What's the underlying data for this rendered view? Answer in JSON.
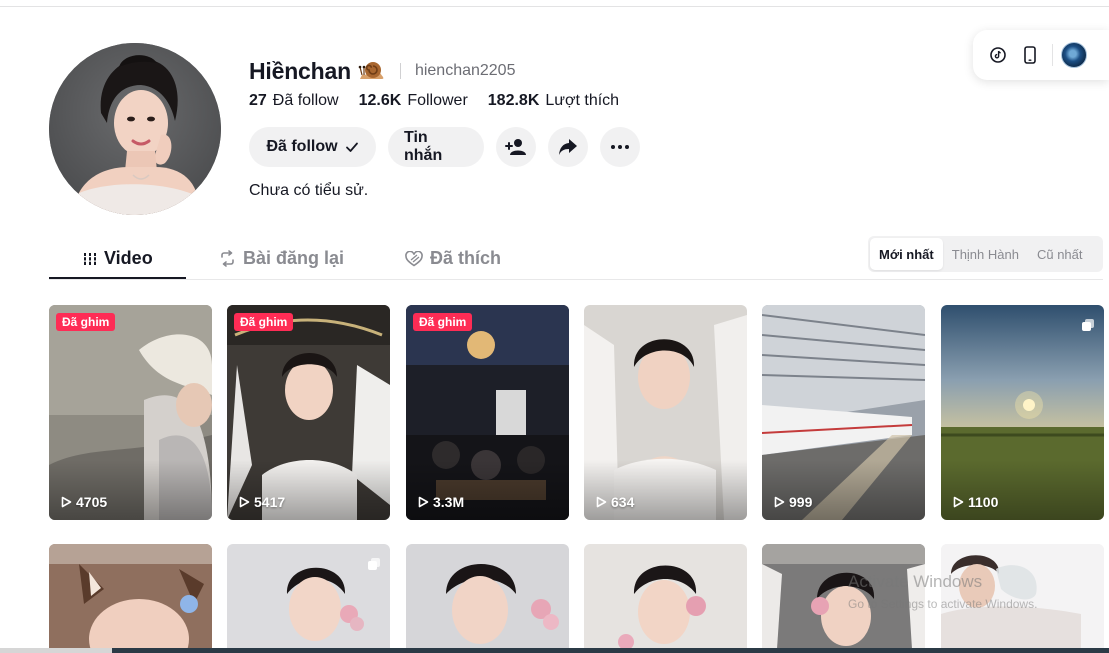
{
  "profile": {
    "display_name": "Hiềnchan",
    "username": "hienchan2205",
    "stats": [
      {
        "value": "27",
        "label": "Đã follow"
      },
      {
        "value": "12.6K",
        "label": "Follower"
      },
      {
        "value": "182.8K",
        "label": "Lượt thích"
      }
    ],
    "actions": {
      "follow_label": "Đã follow",
      "message_label": "Tin nhắn"
    },
    "bio": "Chưa có tiểu sử."
  },
  "tabs": [
    {
      "label": "Video",
      "icon": "grid-lines-icon",
      "active": true
    },
    {
      "label": "Bài đăng lại",
      "icon": "repost-icon",
      "active": false
    },
    {
      "label": "Đã thích",
      "icon": "heart-hidden-icon",
      "active": false
    }
  ],
  "sort": [
    {
      "label": "Mới nhất",
      "active": true
    },
    {
      "label": "Thịnh Hành",
      "active": false
    },
    {
      "label": "Cũ nhất",
      "active": false
    }
  ],
  "videos": [
    {
      "pinned_label": "Đã ghim",
      "views": "4705"
    },
    {
      "pinned_label": "Đã ghim",
      "views": "5417"
    },
    {
      "pinned_label": "Đã ghim",
      "views": "3.3M"
    },
    {
      "pinned_label": "",
      "views": "634"
    },
    {
      "pinned_label": "",
      "views": "999"
    },
    {
      "pinned_label": "",
      "views": "1100",
      "multi_image": true
    }
  ],
  "watermark": {
    "line1": "Activate Windows",
    "line2": "Go to Settings to activate Windows."
  },
  "colors": {
    "accent": "#fe2c55",
    "text": "#161823",
    "muted": "#8a8b91",
    "pill_bg": "#f1f1f2"
  }
}
